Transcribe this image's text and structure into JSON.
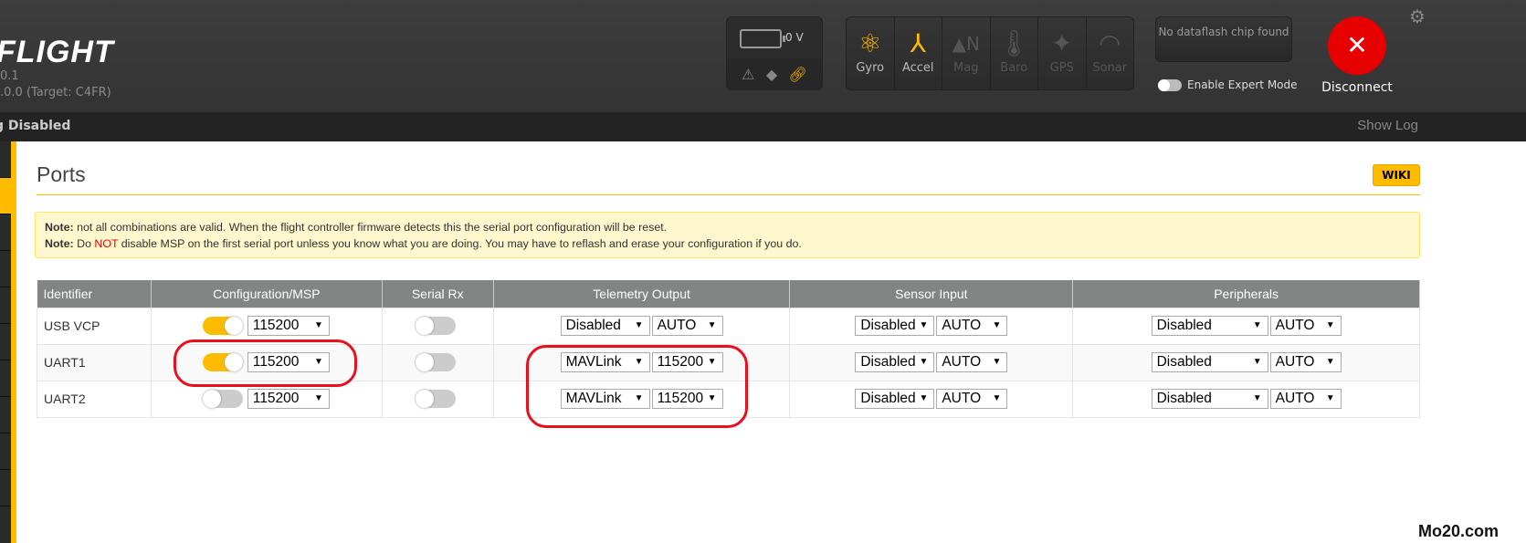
{
  "header": {
    "logo": "FLIGHT",
    "version_line1": "0.1",
    "version_line2": ".0.0 (Target: C4FR)",
    "battery": {
      "voltage": "0 V",
      "icons": [
        "warning-icon",
        "parachute-icon",
        "link-icon"
      ]
    },
    "sensors": [
      {
        "label": "Gyro",
        "icon": "atom",
        "active": true
      },
      {
        "label": "Accel",
        "icon": "axes",
        "active": true
      },
      {
        "label": "Mag",
        "icon": "compass-north",
        "active": false
      },
      {
        "label": "Baro",
        "icon": "thermometer",
        "active": false
      },
      {
        "label": "GPS",
        "icon": "satellite",
        "active": false
      },
      {
        "label": "Sonar",
        "icon": "waves",
        "active": false
      }
    ],
    "dataflash": "No dataflash chip found",
    "expert_mode": "Enable Expert Mode",
    "disconnect": "Disconnect"
  },
  "status": {
    "logging": "g Disabled",
    "show_log": "Show Log"
  },
  "page": {
    "title": "Ports",
    "wiki": "WIKI",
    "note1_label": "Note:",
    "note1": " not all combinations are valid. When the flight controller firmware detects this the serial port configuration will be reset.",
    "note2_label": "Note:",
    "note2_a": " Do ",
    "note2_not": "NOT",
    "note2_b": " disable MSP on the first serial port unless you know what you are doing. You may have to reflash and erase your configuration if you do."
  },
  "table": {
    "headers": [
      "Identifier",
      "Configuration/MSP",
      "Serial Rx",
      "Telemetry Output",
      "Sensor Input",
      "Peripherals"
    ],
    "rows": [
      {
        "id": "USB VCP",
        "msp": true,
        "msp_baud": "115200",
        "rx": false,
        "telem": "Disabled",
        "telem_baud": "AUTO",
        "sensor": "Disabled",
        "sensor_baud": "AUTO",
        "periph": "Disabled",
        "periph_baud": "AUTO"
      },
      {
        "id": "UART1",
        "msp": true,
        "msp_baud": "115200",
        "rx": false,
        "telem": "MAVLink",
        "telem_baud": "115200",
        "sensor": "Disabled",
        "sensor_baud": "AUTO",
        "periph": "Disabled",
        "periph_baud": "AUTO"
      },
      {
        "id": "UART2",
        "msp": false,
        "msp_baud": "115200",
        "rx": false,
        "telem": "MAVLink",
        "telem_baud": "115200",
        "sensor": "Disabled",
        "sensor_baud": "AUTO",
        "periph": "Disabled",
        "periph_baud": "AUTO"
      }
    ]
  },
  "watermark": "Mo20.com",
  "colors": {
    "accent": "#ffbb00",
    "annotation": "#e8101e",
    "disconnect": "#e60000"
  }
}
